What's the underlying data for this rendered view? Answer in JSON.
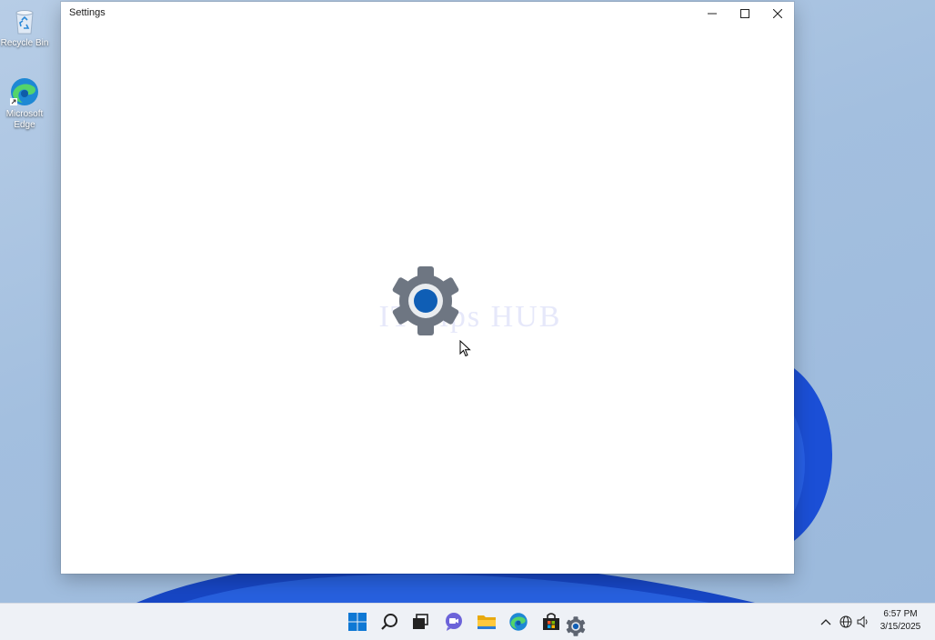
{
  "desktop": {
    "icons": [
      {
        "label": "Recycle Bin",
        "icon": "recycle-bin-icon"
      },
      {
        "label": "Microsoft Edge",
        "icon": "edge-icon"
      }
    ]
  },
  "window": {
    "title": "Settings",
    "controls": [
      "minimize-icon",
      "maximize-icon",
      "close-icon"
    ]
  },
  "splash": {
    "icon": "settings-gear-icon",
    "watermark": "IT Tips HUB"
  },
  "taskbar": {
    "pinned": [
      "start-icon",
      "search-icon",
      "task-view-icon",
      "chat-icon",
      "file-explorer-icon",
      "edge-icon",
      "store-icon",
      "settings-icon"
    ],
    "tray": [
      "chevron-up-icon",
      "network-icon",
      "volume-icon"
    ],
    "clock": {
      "time": "6:57 PM",
      "date": "3/15/2025"
    }
  },
  "colors": {
    "accent": "#0067c0",
    "wallpaper_bloom": "#1b4fd6",
    "taskbar": "#eef1f6"
  }
}
